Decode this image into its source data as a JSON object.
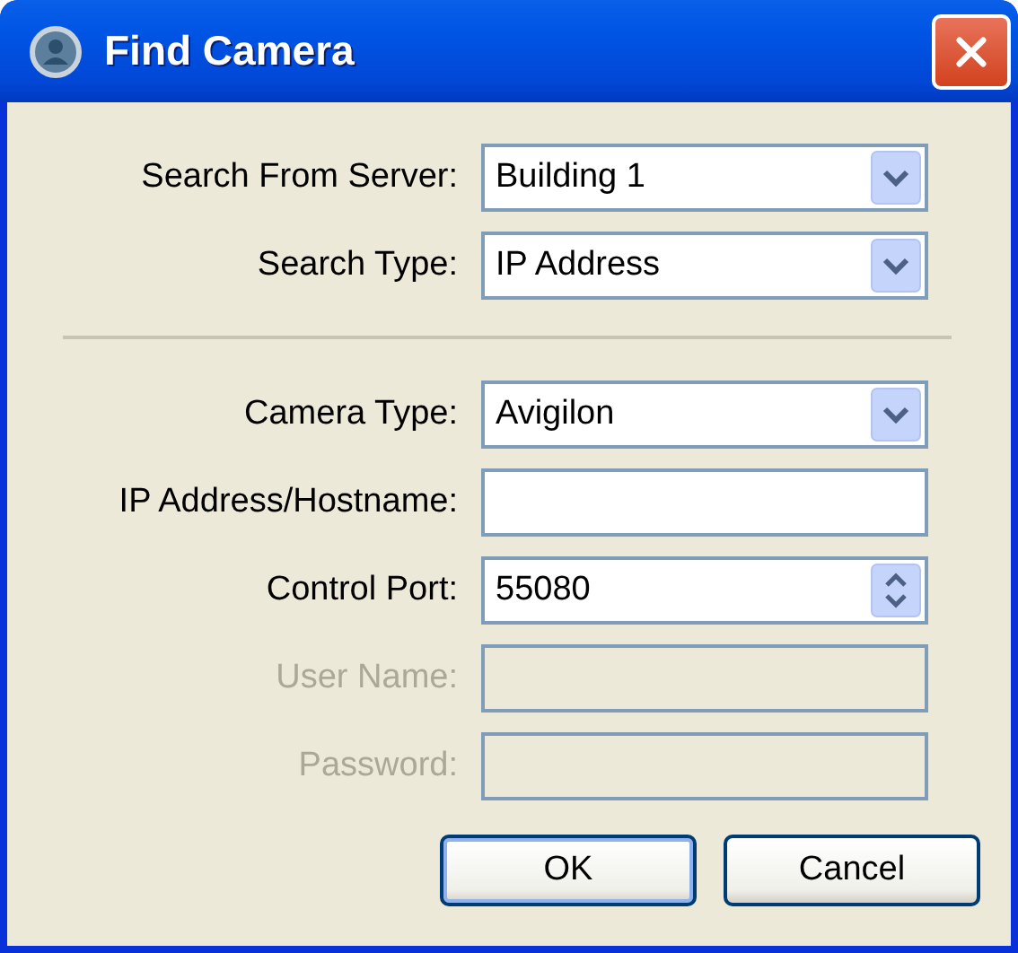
{
  "window": {
    "title": "Find Camera"
  },
  "server_fields": [
    {
      "kind": "dropdown",
      "label": "Search From Server:",
      "value": "Building 1",
      "disabled": false
    },
    {
      "kind": "dropdown",
      "label": "Search Type:",
      "value": "IP Address",
      "disabled": false
    }
  ],
  "camera_fields": [
    {
      "kind": "dropdown",
      "label": "Camera Type:",
      "value": "Avigilon",
      "disabled": false
    },
    {
      "kind": "text",
      "label": "IP Address/Hostname:",
      "disabled": false
    },
    {
      "kind": "spinner",
      "label": "Control Port:",
      "value": "55080",
      "disabled": false
    },
    {
      "kind": "text",
      "label": "User Name:",
      "disabled": true
    },
    {
      "kind": "text",
      "label": "Password:",
      "disabled": true
    }
  ],
  "buttons": [
    {
      "label": "OK",
      "default": true
    },
    {
      "label": "Cancel",
      "default": false
    }
  ]
}
